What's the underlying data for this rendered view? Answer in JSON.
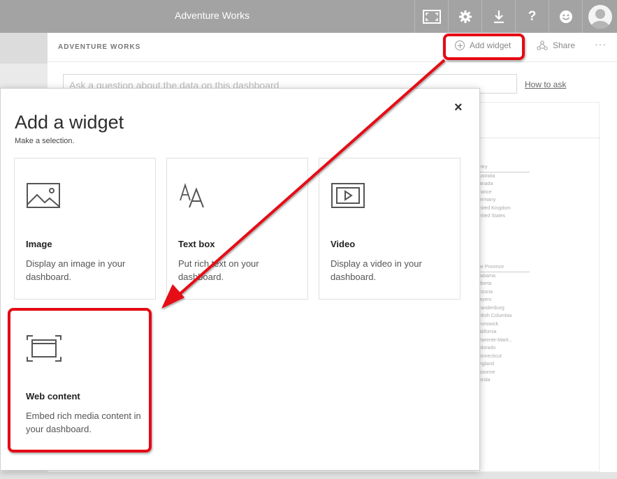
{
  "topbar": {
    "title": "Adventure Works",
    "icons": [
      "fullscreen-icon",
      "gear-icon",
      "download-icon",
      "help-icon",
      "smiley-icon",
      "avatar-icon"
    ],
    "help_glyph": "?"
  },
  "subheader": {
    "dashboard_name": "ADVENTURE WORKS",
    "add_widget_label": "Add widget",
    "share_label": "Share",
    "more_label": "···"
  },
  "qa": {
    "placeholder": "Ask a question about the data on this dashboard",
    "how_to_ask": "How to ask"
  },
  "background_tile": {
    "country_header": "ntry",
    "countries": [
      "ustralia",
      "anada",
      "rance",
      "ermany",
      "nited Kingdom",
      "nited States"
    ],
    "province_header": "te Province",
    "provinces": [
      "labama",
      "lberta",
      "rizona",
      "ayern",
      "randenburg",
      "ritish Columbia",
      "runswick",
      "alifornia",
      "harente-Marit...",
      "olorado",
      "onnecticut",
      "ngland",
      "ssonne",
      "orida"
    ]
  },
  "dialog": {
    "title": "Add a widget",
    "subtitle": "Make a selection.",
    "close_label": "×",
    "widgets": [
      {
        "icon": "image-icon",
        "title": "Image",
        "description": "Display an image in your dashboard."
      },
      {
        "icon": "text-box-icon",
        "title": "Text box",
        "description": "Put rich text on your dashboard."
      },
      {
        "icon": "video-icon",
        "title": "Video",
        "description": "Display a video in your dashboard."
      },
      {
        "icon": "web-content-icon",
        "title": "Web content",
        "description": "Embed rich media content in your dashboard."
      }
    ]
  },
  "annotation": {
    "highlight_color": "#e50914"
  },
  "colors": {
    "topbar_bg": "#a3a3a3",
    "accent_red": "#e50914"
  }
}
